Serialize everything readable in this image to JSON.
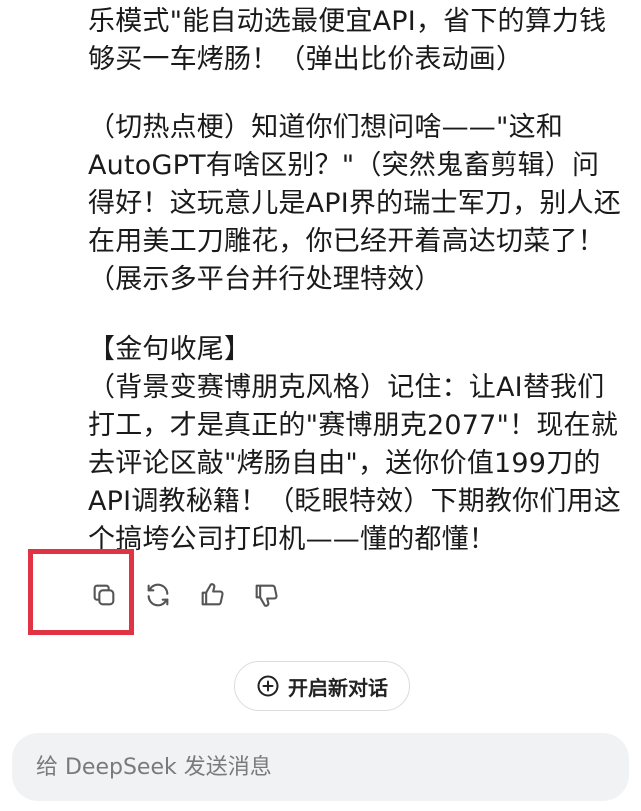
{
  "message": {
    "paragraph1": [
      "乐模式\"能自动选最便宜API，省下的算力钱",
      "够买一车烤肠！（弹出比价表动画）"
    ],
    "paragraph2": [
      "（切热点梗）知道你们想问啥——\"这和",
      "AutoGPT有啥区别？\"（突然鬼畜剪辑）问",
      "得好！这玩意儿是API界的瑞士军刀，别人还",
      "在用美工刀雕花，你已经开着高达切菜了！",
      "（展示多平台并行处理特效）"
    ],
    "paragraph3": [
      "【金句收尾】",
      "（背景变赛博朋克风格）记住：让AI替我们",
      "打工，才是真正的\"赛博朋克2077\"！现在就",
      "去评论区敲\"烤肠自由\"，送你价值199刀的",
      "API调教秘籍！（眨眼特效）下期教你们用这",
      "个搞垮公司打印机——懂的都懂！"
    ]
  },
  "actions": {
    "copy_icon": "copy-icon",
    "regenerate_icon": "refresh-icon",
    "like_icon": "thumbs-up-icon",
    "dislike_icon": "thumbs-down-icon"
  },
  "new_chat": {
    "label": "开启新对话",
    "icon": "plus-circle-icon"
  },
  "input": {
    "placeholder": "给 DeepSeek 发送消息"
  },
  "colors": {
    "highlight": "#e03444",
    "input_bg": "#f1f2f4",
    "text": "#1a1a1a"
  }
}
